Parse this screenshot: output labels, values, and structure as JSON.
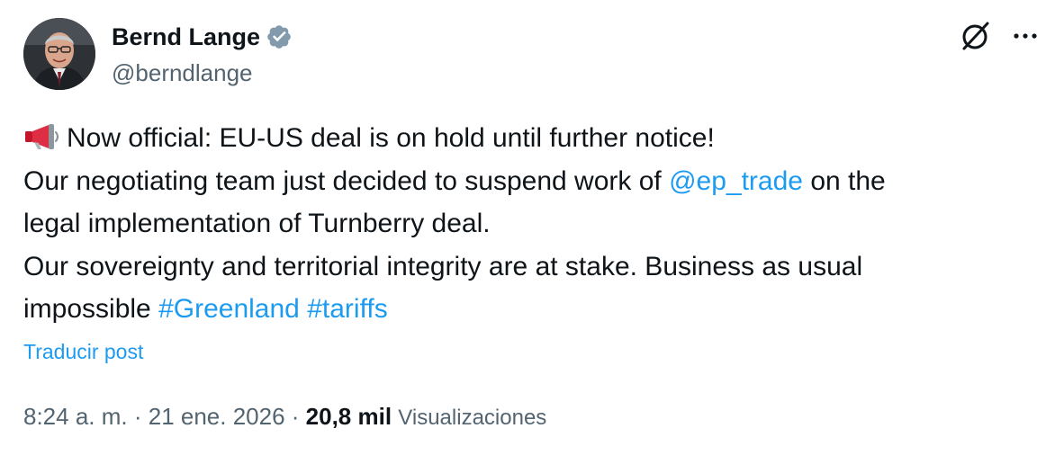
{
  "author": {
    "name": "Bernd Lange",
    "handle": "@berndlange",
    "verified": true,
    "avatar_icon": "profile-photo"
  },
  "header_icons": {
    "grok": "grok-icon",
    "more": "more-options-icon"
  },
  "post": {
    "emoji": "megaphone-icon",
    "line1": "Now official: EU-US deal is on hold until further notice!",
    "line2_pre": "Our negotiating team just decided to suspend work of ",
    "mention": "@ep_trade",
    "line2_post": " on the",
    "line3": "legal implementation of Turnberry deal.",
    "line4": "Our sovereignty and territorial integrity are at stake. Business as usual",
    "line5_pre": "impossible ",
    "hashtag1": "#Greenland",
    "hashtag2": "#tariffs"
  },
  "translate_label": "Traducir post",
  "meta": {
    "time": "8:24 a. m.",
    "sep1": " · ",
    "date": "21 ene. 2026",
    "sep2": " · ",
    "views_count": "20,8 mil",
    "views_label": "Visualizaciones"
  },
  "colors": {
    "link": "#1d9bf0",
    "text": "#0f1419",
    "secondary": "#536471",
    "verified": "#829aab"
  }
}
